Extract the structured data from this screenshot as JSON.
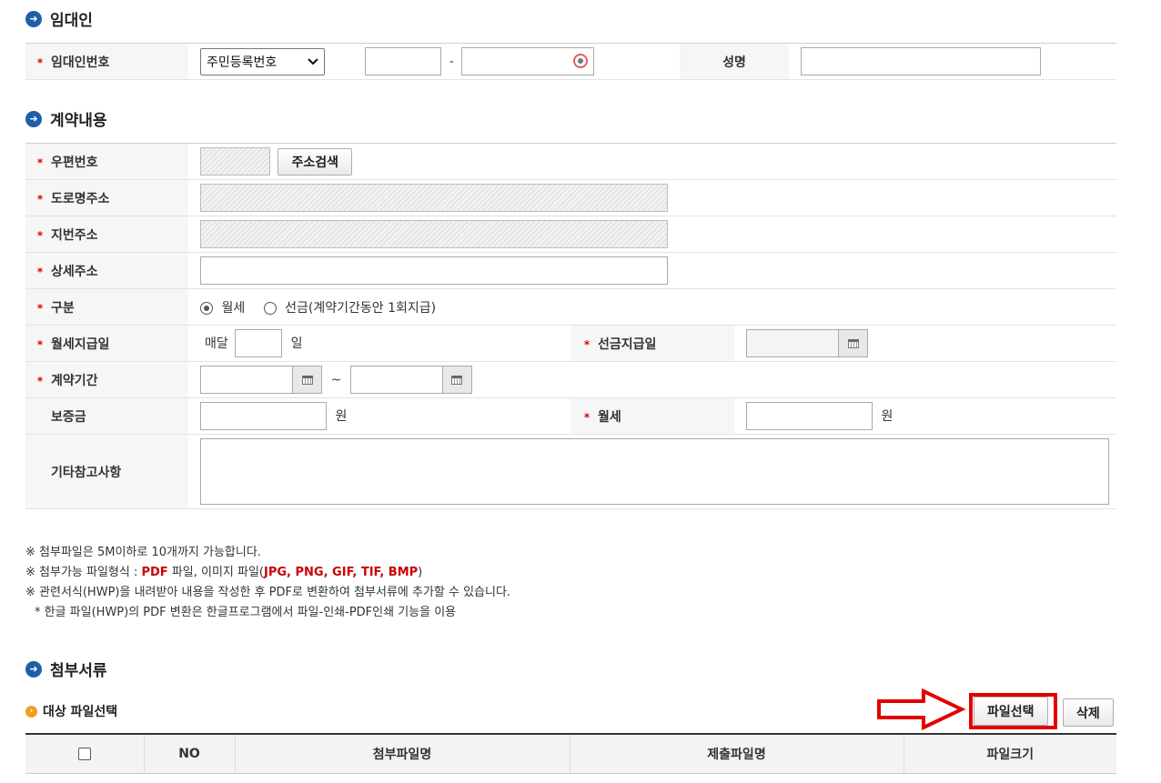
{
  "lessor": {
    "title": "임대인",
    "id_label": "임대인번호",
    "id_type_selected": "주민등록번호",
    "id_separator": "-",
    "name_label": "성명"
  },
  "contract": {
    "title": "계약내용",
    "postcode_label": "우편번호",
    "address_search_button": "주소검색",
    "road_address_label": "도로명주소",
    "jibun_address_label": "지번주소",
    "detail_address_label": "상세주소",
    "type_label": "구분",
    "type_monthly": "월세",
    "type_prepaid": "선금(계약기간동안 1회지급)",
    "monthly_payday_label": "월세지급일",
    "monthly_prefix": "매달",
    "monthly_suffix": "일",
    "prepaid_date_label": "선금지급일",
    "period_label": "계약기간",
    "period_separator": "~",
    "deposit_label": "보증금",
    "deposit_unit": "원",
    "rent_label": "월세",
    "rent_unit": "원",
    "notes_label": "기타참고사항"
  },
  "notes": {
    "line1": "※ 첨부파일은 5M이하로 10개까지 가능합니다.",
    "line2_prefix": "※ 첨부가능 파일형식 : ",
    "line2_pdf": "PDF",
    "line2_mid": " 파일, 이미지 파일(",
    "line2_img": "JPG, PNG, GIF, TIF, BMP",
    "line2_suffix": ")",
    "line3": "※ 관련서식(HWP)을 내려받아 내용을 작성한 후 PDF로 변환하여 첨부서류에 추가할 수 있습니다.",
    "line4": "* 한글 파일(HWP)의 PDF 변환은 한글프로그램에서 파일-인쇄-PDF인쇄 기능을 이용"
  },
  "attachments": {
    "title": "첨부서류",
    "subtitle": "대상 파일선택",
    "select_file_button": "파일선택",
    "delete_button": "삭제",
    "columns": [
      "NO",
      "첨부파일명",
      "제출파일명",
      "파일크기"
    ]
  },
  "colors": {
    "required_star": "#dd0000",
    "highlight_box": "#e50000",
    "section_icon": "#1f5fa8"
  }
}
